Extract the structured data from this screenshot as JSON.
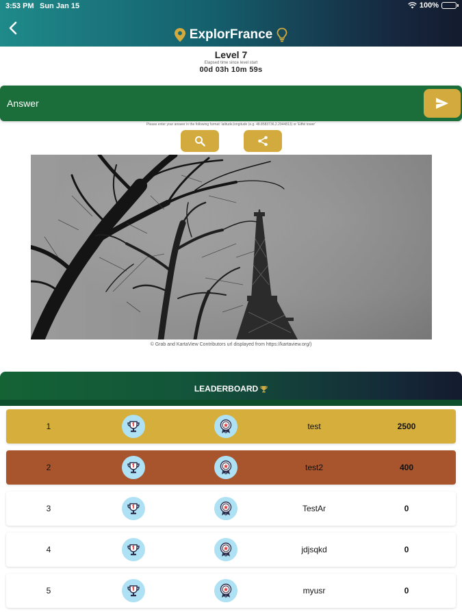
{
  "status_bar": {
    "time": "3:53 PM",
    "date": "Sun Jan 15",
    "battery": "100%"
  },
  "header": {
    "title": "ExplorFrance",
    "back_icon": "chevron-left-icon",
    "left_icon": "map-pin-icon",
    "right_icon": "lightbulb-icon"
  },
  "level": {
    "title": "Level 7",
    "elapsed_label": "Elapsed time since level start",
    "elapsed_value": "00d 03h 10m 59s"
  },
  "answer": {
    "placeholder": "Answer",
    "hint": "Please enter your answer in the following format: latitude,longitude (e.g. 48.8583736,2.2944813) or 'Eiffel tower'"
  },
  "photo": {
    "caption": "© Grab and KartaView Contributors url displayed from https://kartaview.org/)"
  },
  "leaderboard": {
    "title": "LEADERBOARD",
    "rows": [
      {
        "rank": "1",
        "name": "test",
        "score": "2500",
        "style": "gold"
      },
      {
        "rank": "2",
        "name": "test2",
        "score": "400",
        "style": "bronze"
      },
      {
        "rank": "3",
        "name": "TestAr",
        "score": "0",
        "style": "white"
      },
      {
        "rank": "4",
        "name": "jdjsqkd",
        "score": "0",
        "style": "white"
      },
      {
        "rank": "5",
        "name": "myusr",
        "score": "0",
        "style": "white"
      }
    ]
  },
  "colors": {
    "accent_gold": "#d3aa3d",
    "answer_green": "#1b6e3a",
    "row_gold": "#d6ae3b",
    "row_bronze": "#a8542c"
  }
}
